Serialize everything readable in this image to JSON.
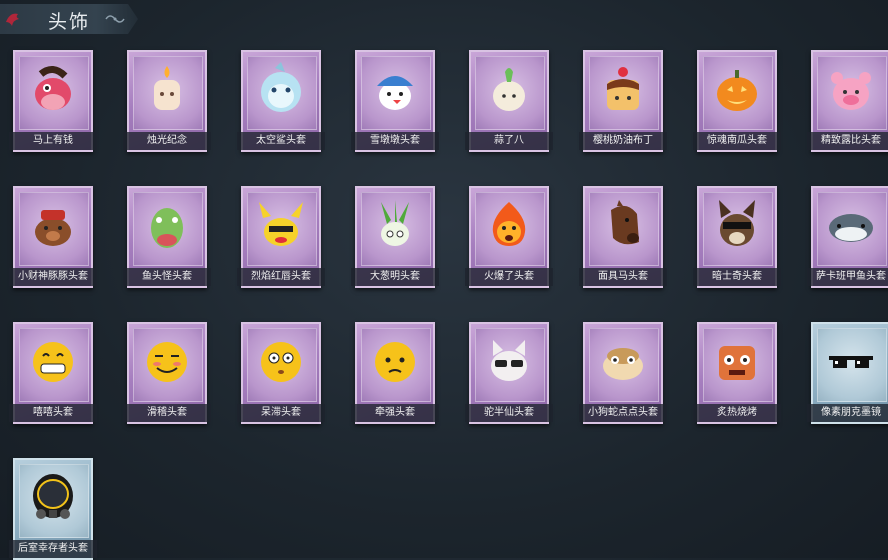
{
  "header": {
    "title": "头饰"
  },
  "items": [
    {
      "label": "马上有钱",
      "icon": "horse-mask-icon",
      "skin": "purple"
    },
    {
      "label": "烛光纪念",
      "icon": "candle-mask-icon",
      "skin": "purple"
    },
    {
      "label": "太空鲨头套",
      "icon": "shark-mask-icon",
      "skin": "purple"
    },
    {
      "label": "雪墩墩头套",
      "icon": "snowman-mask-icon",
      "skin": "purple"
    },
    {
      "label": "蒜了八",
      "icon": "garlic-mask-icon",
      "skin": "purple"
    },
    {
      "label": "樱桃奶油布丁",
      "icon": "pudding-mask-icon",
      "skin": "purple"
    },
    {
      "label": "惊魂南瓜头套",
      "icon": "pumpkin-mask-icon",
      "skin": "purple"
    },
    {
      "label": "精致露比头套",
      "icon": "pink-bear-mask-icon",
      "skin": "purple"
    },
    {
      "label": "小财神豚豚头套",
      "icon": "pig-mask-icon",
      "skin": "purple"
    },
    {
      "label": "鱼头怪头套",
      "icon": "fish-head-mask-icon",
      "skin": "purple"
    },
    {
      "label": "烈焰红唇头套",
      "icon": "yellow-mouse-mask-icon",
      "skin": "purple"
    },
    {
      "label": "大葱明头套",
      "icon": "scallion-mask-icon",
      "skin": "purple"
    },
    {
      "label": "火爆了头套",
      "icon": "fire-mask-icon",
      "skin": "purple"
    },
    {
      "label": "面具马头套",
      "icon": "horse-head-mask-icon",
      "skin": "purple"
    },
    {
      "label": "暗士奇头套",
      "icon": "husky-mask-icon",
      "skin": "purple"
    },
    {
      "label": "萨卡班甲鱼头套",
      "icon": "sacabambaspis-mask-icon",
      "skin": "purple"
    },
    {
      "label": "嘻嘻头套",
      "icon": "grin-emoji-icon",
      "skin": "purple"
    },
    {
      "label": "滑稽头套",
      "icon": "smirk-emoji-icon",
      "skin": "purple"
    },
    {
      "label": "呆滞头套",
      "icon": "dazed-emoji-icon",
      "skin": "purple"
    },
    {
      "label": "牵强头套",
      "icon": "pleading-emoji-icon",
      "skin": "purple"
    },
    {
      "label": "驼半仙头套",
      "icon": "cat-shades-mask-icon",
      "skin": "purple"
    },
    {
      "label": "小狗蛇点点头套",
      "icon": "snake-mask-icon",
      "skin": "purple"
    },
    {
      "label": "炙热烧烤",
      "icon": "toast-mask-icon",
      "skin": "purple"
    },
    {
      "label": "像素朋克墨镜",
      "icon": "pixel-sunglasses-icon",
      "skin": "blue"
    },
    {
      "label": "后室幸存者头套",
      "icon": "gas-mask-helmet-icon",
      "skin": "blue"
    }
  ]
}
